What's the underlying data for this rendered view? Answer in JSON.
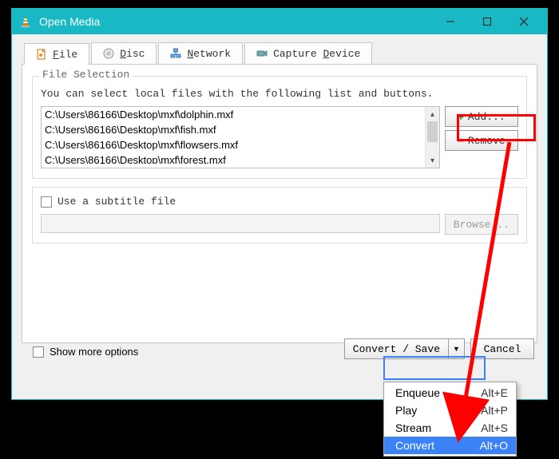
{
  "window": {
    "title": "Open Media"
  },
  "tabs": {
    "file": "File",
    "disc": "Disc",
    "network": "Network",
    "capture": "Capture Device"
  },
  "fileSection": {
    "legend": "File Selection",
    "hint": "You can select local files with the following list and buttons.",
    "items": [
      "C:\\Users\\86166\\Desktop\\mxf\\dolphin.mxf",
      "C:\\Users\\86166\\Desktop\\mxf\\fish.mxf",
      "C:\\Users\\86166\\Desktop\\mxf\\flowsers.mxf",
      "C:\\Users\\86166\\Desktop\\mxf\\forest.mxf"
    ],
    "addLabel": "Add...",
    "removeLabel": "Remove"
  },
  "subtitle": {
    "check": "Use a subtitle file",
    "browse": "Browse..."
  },
  "showMore": "Show more options",
  "actions": {
    "convertSave": "Convert / Save",
    "cancel": "Cancel"
  },
  "dropdown": {
    "items": [
      {
        "label": "Enqueue",
        "accel": "Alt+E"
      },
      {
        "label": "Play",
        "accel": "Alt+P"
      },
      {
        "label": "Stream",
        "accel": "Alt+S"
      },
      {
        "label": "Convert",
        "accel": "Alt+O"
      }
    ],
    "selectedIndex": 3
  }
}
